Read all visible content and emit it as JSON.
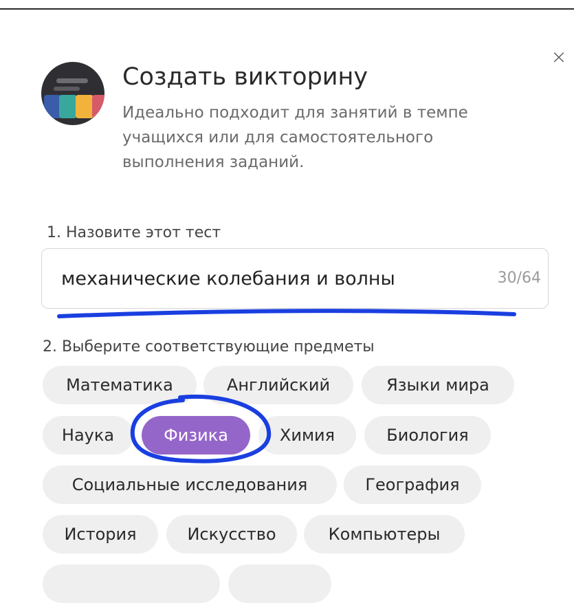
{
  "header": {
    "title": "Создать викторину",
    "subtitle": "Идеально подходит для занятий в темпе учащихся или для самостоятельного выполнения заданий.",
    "close_icon": "×"
  },
  "step1": {
    "label": "1. Назовите этот тест",
    "value": "механические колебания и волны",
    "counter": "30/64"
  },
  "step2": {
    "label": "2. Выберите соответствующие предметы",
    "subjects": [
      "Математика",
      "Английский",
      "Языки мира",
      "Наука",
      "Физика",
      "Химия",
      "Биология",
      "Социальные исследования",
      "География",
      "История",
      "Искусство",
      "Компьютеры"
    ],
    "selected": "Физика"
  },
  "colors": {
    "selected_chip": "#9566c9",
    "chip": "#efefef",
    "annotation": "#1a3fe0"
  }
}
